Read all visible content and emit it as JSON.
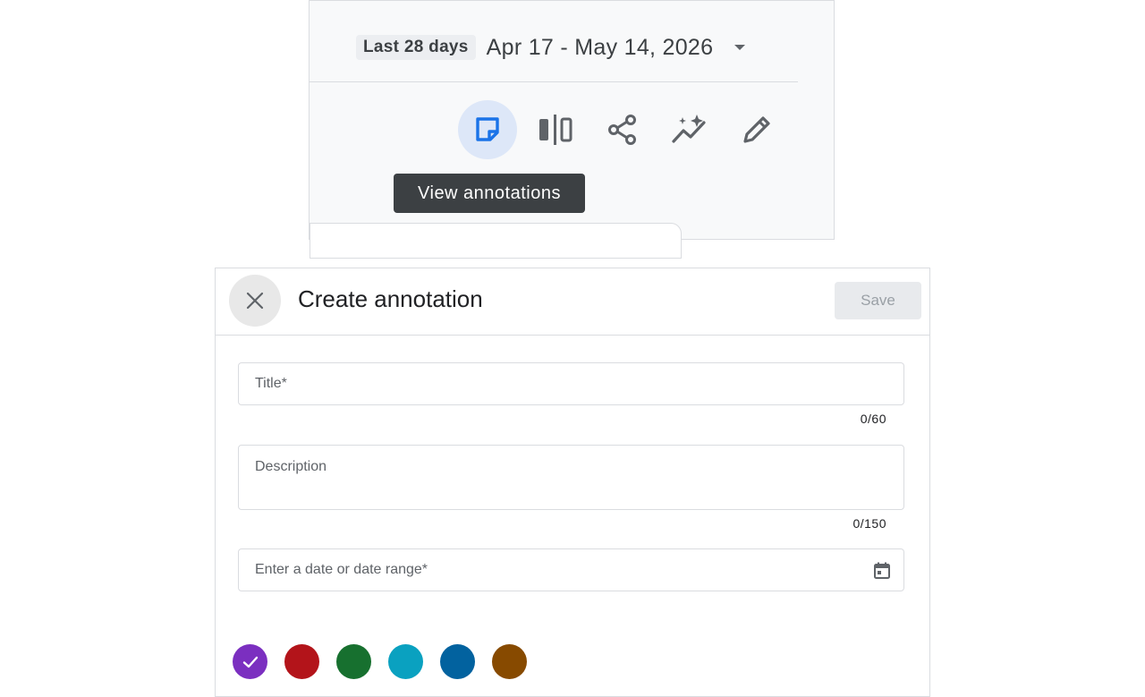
{
  "toolbar": {
    "date_chip": "Last 28 days",
    "date_range": "Apr 17 - May 14, 2026",
    "tooltip": "View annotations",
    "icons": [
      "annotations-icon",
      "compare-icon",
      "share-icon",
      "insights-icon",
      "edit-icon"
    ],
    "active_color": "#1a73e8"
  },
  "dialog": {
    "title": "Create annotation",
    "save_label": "Save",
    "fields": {
      "title": {
        "placeholder": "Title*",
        "value": "",
        "counter": "0/60"
      },
      "description": {
        "placeholder": "Description",
        "value": "",
        "counter": "0/150"
      },
      "date": {
        "placeholder": "Enter a date or date range*",
        "value": ""
      }
    },
    "colors": [
      {
        "name": "purple",
        "hex": "#7b2fc0",
        "selected": true
      },
      {
        "name": "red",
        "hex": "#b3141a",
        "selected": false
      },
      {
        "name": "green",
        "hex": "#17702f",
        "selected": false
      },
      {
        "name": "teal",
        "hex": "#0aa1c0",
        "selected": false
      },
      {
        "name": "blue",
        "hex": "#02629f",
        "selected": false
      },
      {
        "name": "brown",
        "hex": "#874a00",
        "selected": false
      }
    ]
  }
}
